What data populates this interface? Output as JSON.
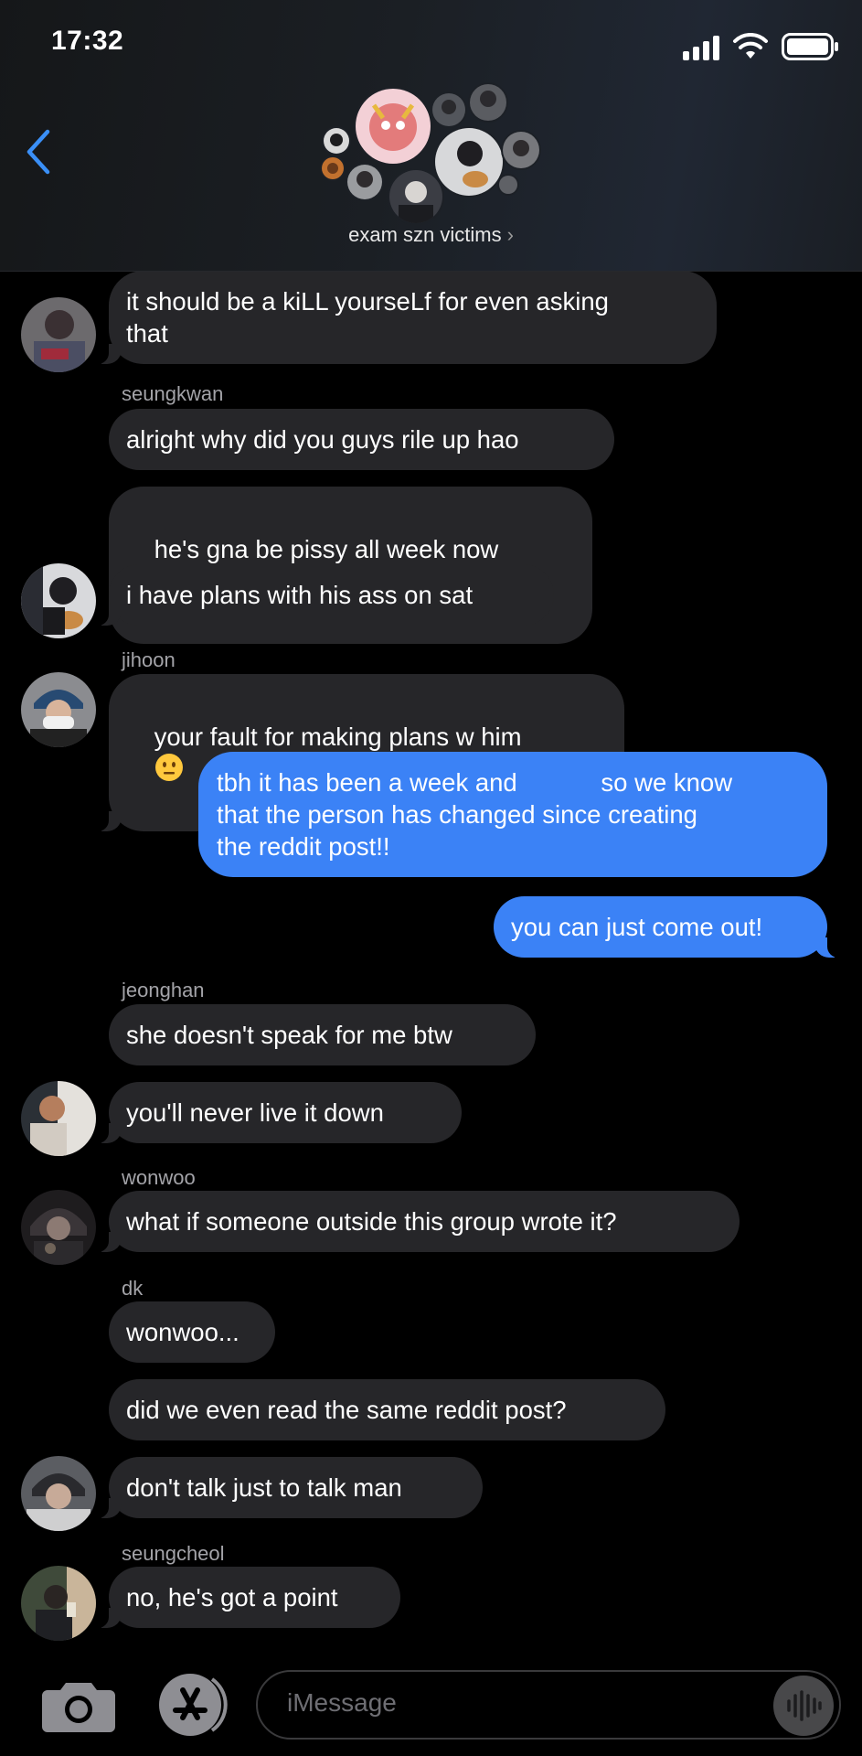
{
  "status_bar": {
    "time": "17:32"
  },
  "header": {
    "group_name": "exam szn victims",
    "chevron": "›"
  },
  "messages": [
    {
      "text": "it should be a kiLL yourseLf for even asking\nthat"
    },
    {
      "sender": "seungkwan",
      "text": "alright why did you guys rile up hao"
    },
    {
      "text": "he's gna be pissy all week now"
    },
    {
      "text": "i have plans with his ass on sat"
    },
    {
      "sender": "jihoon",
      "text": "your fault for making plans w him"
    },
    {
      "text": "tbh it has been a week and            so we know\nthat the person has changed since creating\nthe reddit post!!"
    },
    {
      "text": "you can just come out!"
    },
    {
      "sender": "jeonghan",
      "text": "she doesn't speak for me btw"
    },
    {
      "text": "you'll never live it down"
    },
    {
      "sender": "wonwoo",
      "text": "what if someone outside this group wrote it?"
    },
    {
      "sender": "dk",
      "text": "wonwoo..."
    },
    {
      "text": "did we even read the same reddit post?"
    },
    {
      "text": "don't talk just to talk man"
    },
    {
      "sender": "seungcheol",
      "text": "no, he's got a point"
    }
  ],
  "composer": {
    "placeholder": "iMessage"
  },
  "colors": {
    "outgoing": "#3b82f6",
    "incoming": "#262629",
    "background": "#000000",
    "accent": "#3a8ff7"
  }
}
